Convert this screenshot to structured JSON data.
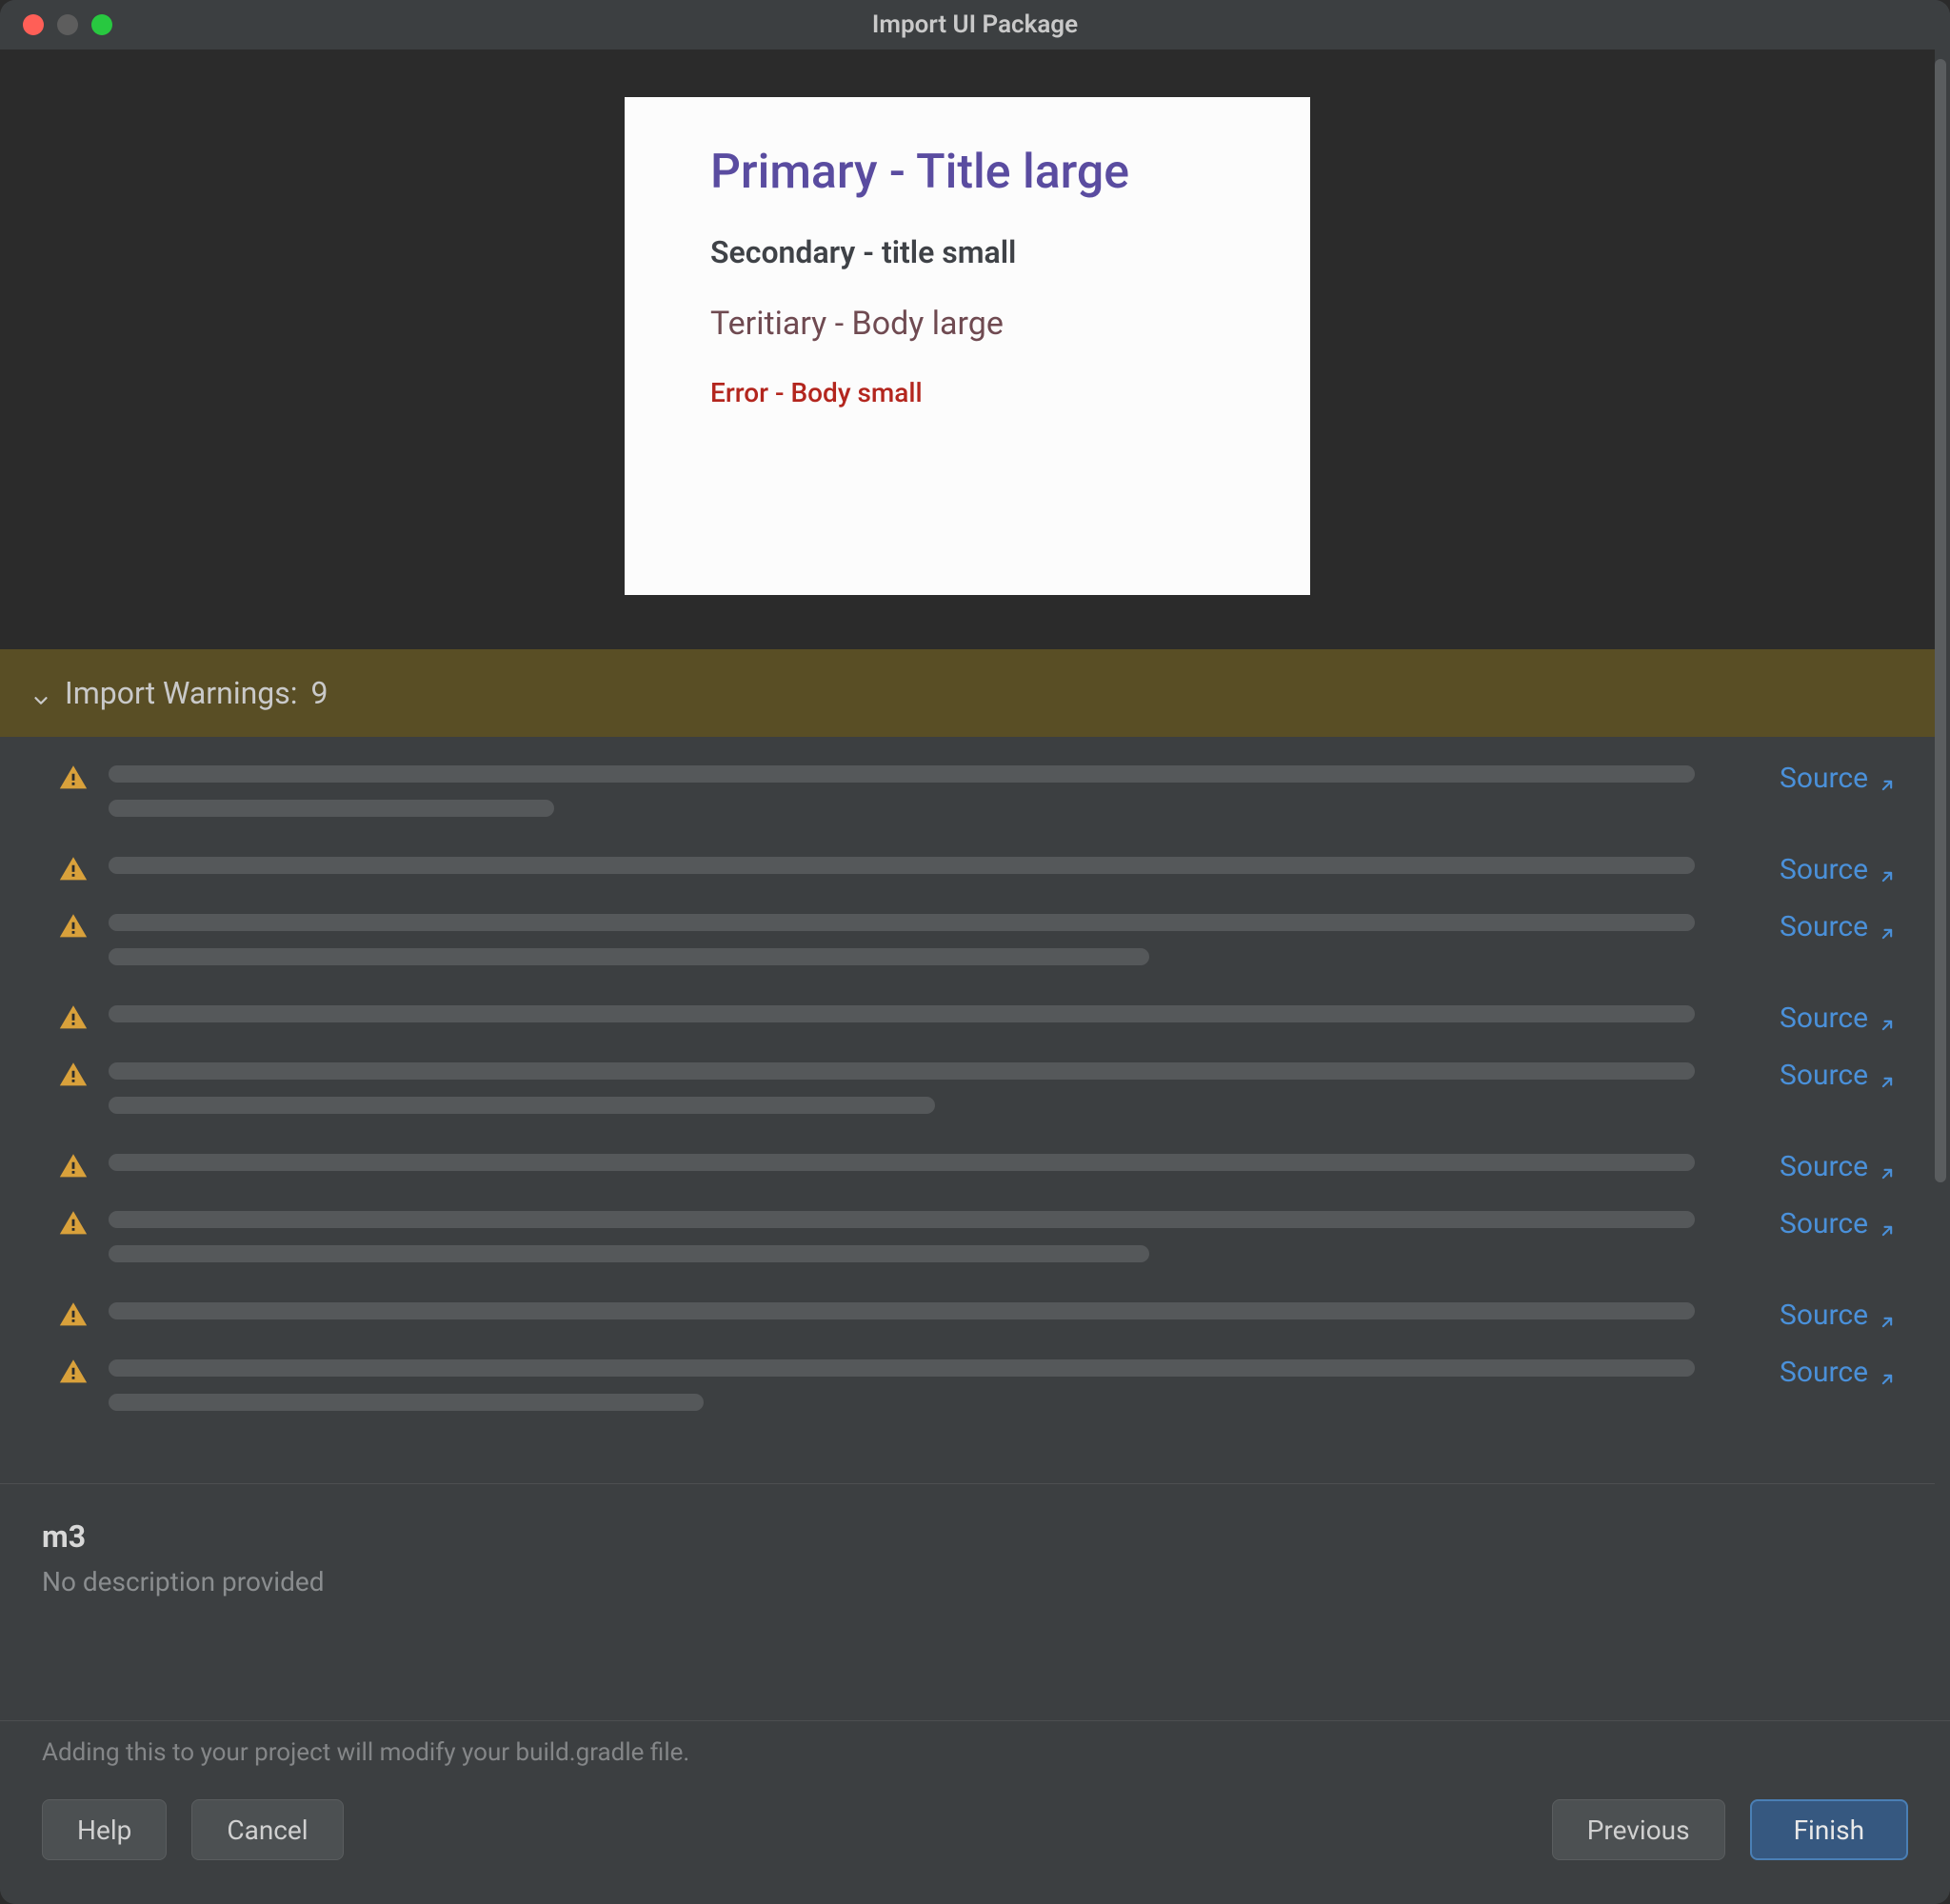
{
  "window": {
    "title": "Import UI Package"
  },
  "preview": {
    "primary": "Primary - Title large",
    "secondary": "Secondary - title small",
    "tertiary": "Teritiary - Body large",
    "error": "Error - Body small"
  },
  "warnings": {
    "header_prefix": "Import Warnings: ",
    "count": "9",
    "source_label": "Source",
    "rows": [
      {
        "bars": [
          96,
          27
        ]
      },
      {
        "bars": [
          96
        ]
      },
      {
        "bars": [
          96,
          63
        ]
      },
      {
        "bars": [
          96
        ]
      },
      {
        "bars": [
          96,
          50
        ]
      },
      {
        "bars": [
          96
        ]
      },
      {
        "bars": [
          96,
          63
        ]
      },
      {
        "bars": [
          96
        ]
      },
      {
        "bars": [
          96,
          36
        ]
      }
    ]
  },
  "meta": {
    "name": "m3",
    "description": "No description provided"
  },
  "footer": {
    "note": "Adding this to your project will modify your build.gradle file.",
    "help": "Help",
    "cancel": "Cancel",
    "previous": "Previous",
    "finish": "Finish"
  }
}
